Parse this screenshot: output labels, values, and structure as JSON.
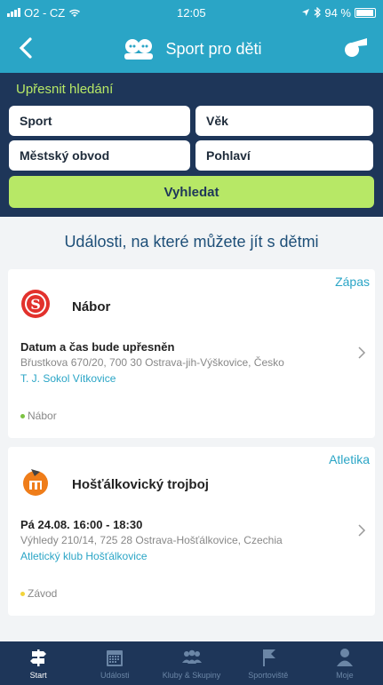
{
  "status": {
    "carrier": "O2 - CZ",
    "time": "12:05",
    "battery": "94 %"
  },
  "nav": {
    "title": "Sport pro děti"
  },
  "filter": {
    "title": "Upřesnit hledání",
    "sport": "Sport",
    "age": "Věk",
    "district": "Městský obvod",
    "gender": "Pohlaví",
    "search_button": "Vyhledat"
  },
  "headline": "Události, na které můžete jít s dětmi",
  "events": [
    {
      "category": "Zápas",
      "title": "Nábor",
      "when": "Datum a čas bude upřesněn",
      "address": "Břustkova 670/20, 700 30 Ostrava-jih-Výškovice, Česko",
      "club": "T. J. Sokol Vítkovice",
      "tag": "Nábor",
      "tag_color": "#7cc243"
    },
    {
      "category": "Atletika",
      "title": "Hošťálkovický trojboj",
      "when": "Pá 24.08. 16:00 - 18:30",
      "address": "Výhledy 210/14, 725 28 Ostrava-Hošťálkovice, Czechia",
      "club": "Atletický klub Hošťálkovice",
      "tag": "Závod",
      "tag_color": "#f2d43b"
    }
  ],
  "tabs": [
    {
      "label": "Start",
      "icon": "signpost-icon",
      "active": true
    },
    {
      "label": "Události",
      "icon": "calendar-icon",
      "active": false
    },
    {
      "label": "Kluby & Skupiny",
      "icon": "group-icon",
      "active": false
    },
    {
      "label": "Sportoviště",
      "icon": "flag-icon",
      "active": false
    },
    {
      "label": "Moje",
      "icon": "person-icon",
      "active": false
    }
  ]
}
